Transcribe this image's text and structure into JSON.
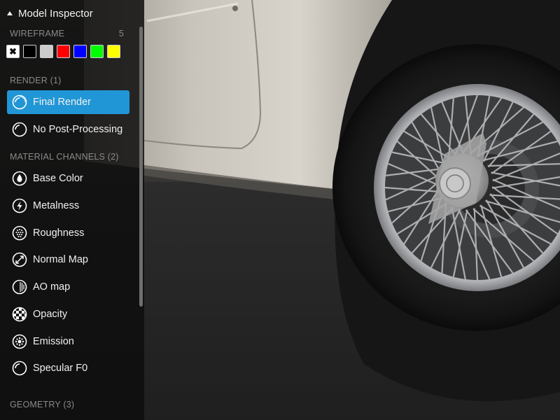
{
  "panel": {
    "title": "Model Inspector",
    "wireframe": {
      "label": "WIREFRAME",
      "count": "5",
      "swatches": [
        {
          "name": "none",
          "color": "#ffffff",
          "icon": "close-icon"
        },
        {
          "name": "black",
          "color": "#000000"
        },
        {
          "name": "grey",
          "color": "#cccccc"
        },
        {
          "name": "red",
          "color": "#ff0000"
        },
        {
          "name": "blue",
          "color": "#0000ff"
        },
        {
          "name": "green",
          "color": "#00ff00"
        },
        {
          "name": "yellow",
          "color": "#ffff00"
        }
      ]
    },
    "render": {
      "label": "RENDER (1)",
      "items": [
        {
          "label": "Final Render",
          "icon": "final-render-icon",
          "active": true
        },
        {
          "label": "No Post-Processing",
          "icon": "no-post-processing-icon",
          "active": false
        }
      ]
    },
    "material": {
      "label": "MATERIAL CHANNELS (2)",
      "items": [
        {
          "label": "Base Color",
          "icon": "base-color-icon"
        },
        {
          "label": "Metalness",
          "icon": "metalness-icon"
        },
        {
          "label": "Roughness",
          "icon": "roughness-icon"
        },
        {
          "label": "Normal Map",
          "icon": "normal-map-icon"
        },
        {
          "label": "AO map",
          "icon": "ao-map-icon"
        },
        {
          "label": "Opacity",
          "icon": "opacity-icon"
        },
        {
          "label": "Emission",
          "icon": "emission-icon"
        },
        {
          "label": "Specular F0",
          "icon": "specular-f0-icon"
        }
      ]
    },
    "geometry": {
      "label": "GEOMETRY (3)"
    },
    "accent_color": "#2196d6"
  }
}
